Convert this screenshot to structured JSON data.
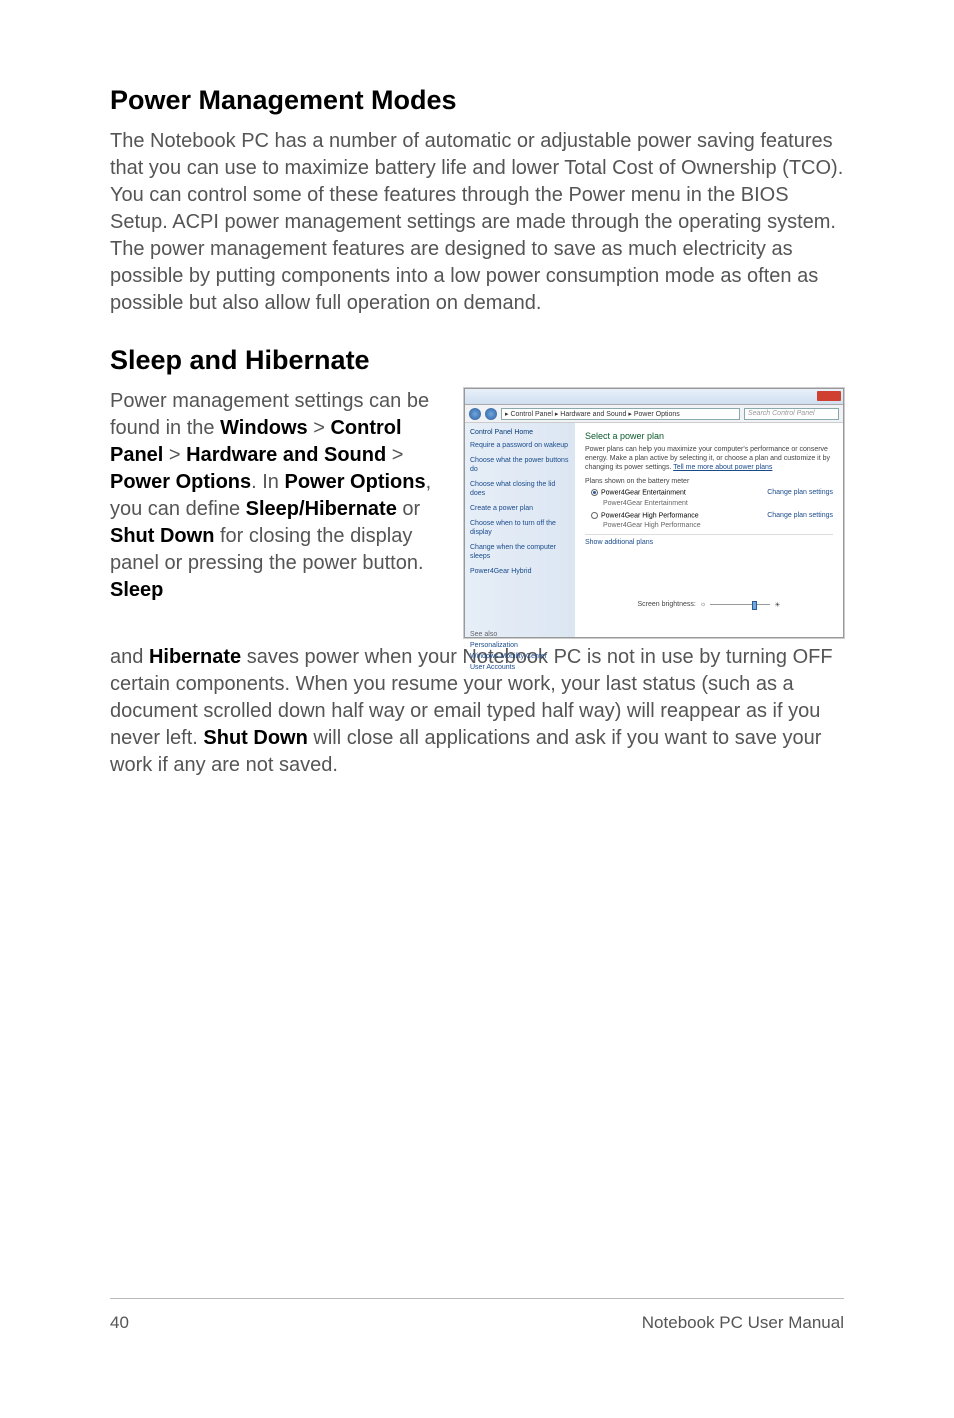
{
  "heading1": "Power Management Modes",
  "para1": "The Notebook PC has a number of automatic or adjustable power saving features that you can use to maximize battery life and lower Total Cost of Ownership (TCO). You can control some of these features through the Power menu in the BIOS Setup. ACPI power management settings are made through the operating system. The power management features are designed to save as much electricity as possible by putting components into a low power consumption mode as often as possible but also allow full operation on demand.",
  "heading2": "Sleep and Hibernate",
  "para2_pre": "Power management settings can be found in the ",
  "para2_windows": "Windows",
  "para2_gt1": " > ",
  "para2_cp": "Control Panel",
  "para2_gt2": " > ",
  "para2_hs": "Hardware and Sound",
  "para2_gt3": " > ",
  "para2_po": "Power Options",
  "para2_after_po": ". In ",
  "para2_po2": "Power Options",
  "para2_define": ", you can define ",
  "para2_sh": "Sleep/Hibernate",
  "para2_or": " or ",
  "para2_sd": "Shut Down",
  "para2_close": " for closing the display panel or pressing the power button. ",
  "para2_sleep": "Sleep",
  "para3_pre": "and ",
  "para3_hib": "Hibernate",
  "para3_mid": " saves power when your Notebook PC is not in use by turning OFF certain components. When you resume your work, your last status (such as a document scrolled down half way or email typed half way) will reappear as if you never left. ",
  "para3_sd": "Shut Down",
  "para3_end": " will close all applications and ask if you want to save your work if any are not saved.",
  "footer": {
    "page": "40",
    "title": "Notebook PC User Manual"
  },
  "screenshot": {
    "breadcrumb": "▸ Control Panel ▸ Hardware and Sound ▸ Power Options",
    "search_placeholder": "Search Control Panel",
    "sidebar": {
      "home": "Control Panel Home",
      "links": [
        "Require a password on wakeup",
        "Choose what the power buttons do",
        "Choose what closing the lid does",
        "Create a power plan",
        "Choose when to turn off the display",
        "Change when the computer sleeps",
        "Power4Gear Hybrid"
      ],
      "seealso": "See also",
      "seealso_items": [
        "Personalization",
        "Windows Mobility Center",
        "User Accounts"
      ]
    },
    "main": {
      "heading": "Select a power plan",
      "desc_pre": "Power plans can help you maximize your computer's performance or conserve energy. Make a plan active by selecting it, or choose a plan and customize it by changing its power settings. ",
      "desc_link": "Tell me more about power plans",
      "group_label": "Plans shown on the battery meter",
      "plan1_name": "Power4Gear Entertainment",
      "plan1_sub": "Power4Gear Entertainment",
      "plan2_name": "Power4Gear High Performance",
      "plan2_sub": "Power4Gear High Performance",
      "change_link": "Change plan settings",
      "show_more": "Show additional plans",
      "brightness_label": "Screen brightness:"
    }
  }
}
